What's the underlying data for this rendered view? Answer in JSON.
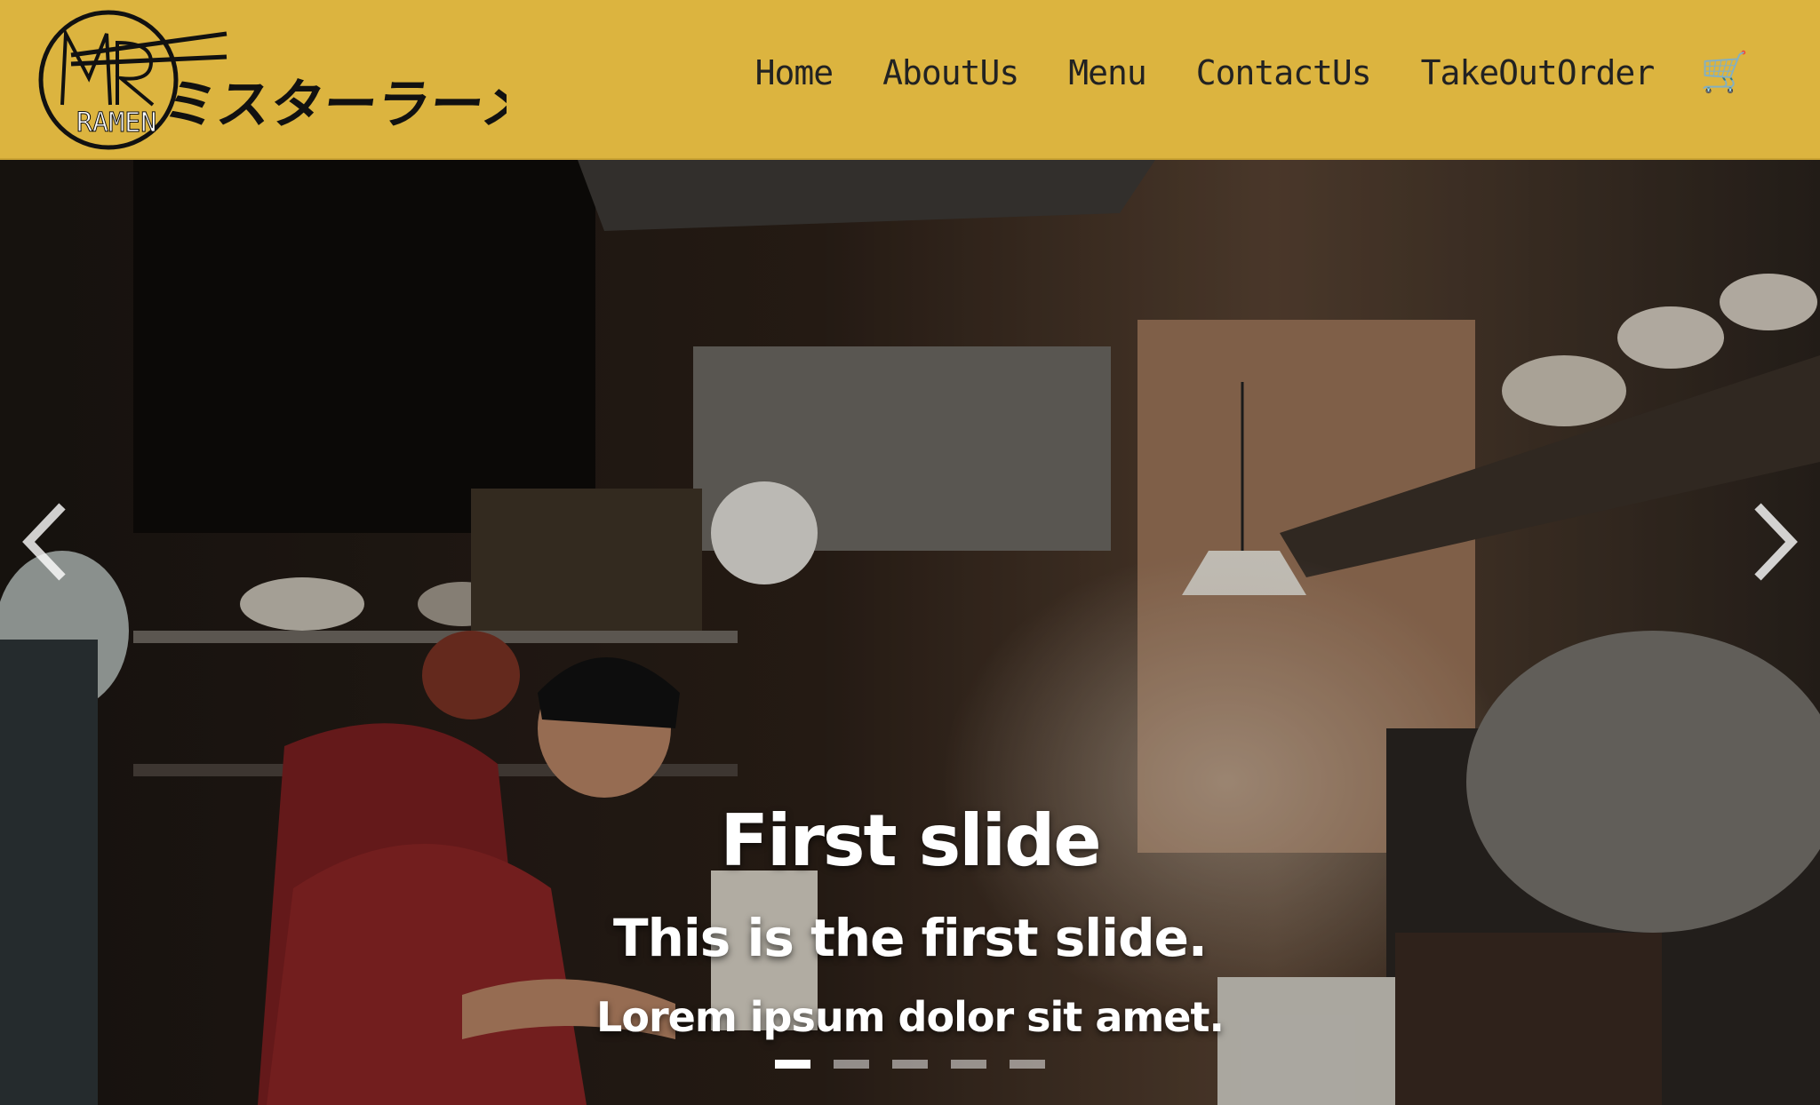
{
  "brand": {
    "logo_text": "MR RAMEN",
    "name_text": "ミスターラーメン"
  },
  "nav": {
    "items": [
      {
        "label": "Home"
      },
      {
        "label": "AboutUs"
      },
      {
        "label": "Menu"
      },
      {
        "label": "ContactUs"
      },
      {
        "label": "TakeOutOrder"
      }
    ],
    "cart_icon": "🛒"
  },
  "carousel": {
    "title": "First slide",
    "subtitle": "This is the first slide.",
    "text": "Lorem ipsum dolor sit amet.",
    "slide_count": 5,
    "active_index": 0
  },
  "colors": {
    "navbar": "#dcb43f",
    "nav_text": "#222222"
  }
}
